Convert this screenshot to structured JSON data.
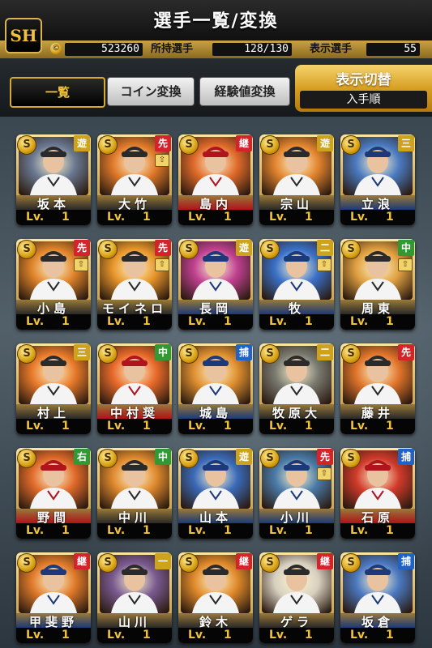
{
  "header": {
    "title": "選手一覧/変換",
    "logo_text": "SH",
    "coins": "523260",
    "owned_label": "所持選手",
    "owned_value": "128/130",
    "shown_label": "表示選手",
    "shown_value": "55"
  },
  "tabs": [
    {
      "label": "一覧",
      "active": true
    },
    {
      "label": "コイン変換",
      "active": false
    },
    {
      "label": "経験値変換",
      "active": false
    }
  ],
  "sort": {
    "title": "表示切替",
    "value": "入手順"
  },
  "colors": {
    "gold": "#f0c23a",
    "pos_red": "#d3242c",
    "pos_yellow": "#cfa21c",
    "pos_green": "#2f9a34",
    "pos_blue": "#1f62c8"
  },
  "cards": [
    {
      "name": "坂本",
      "pos": "遊",
      "pos_color": "#cfa21c",
      "lv_label": "Lv.",
      "lv": "1",
      "bg": "#6a7890",
      "frame": "#c8a050",
      "ribbon": "#2a2a2a"
    },
    {
      "name": "大竹",
      "pos": "先",
      "pos_color": "#d3242c",
      "lv_label": "Lv.",
      "lv": "1",
      "bg": "#e07a2a",
      "frame": "#d5a040",
      "ribbon": "#2a2a2a",
      "up": true
    },
    {
      "name": "島内",
      "pos": "継",
      "pos_color": "#d3242c",
      "lv_label": "Lv.",
      "lv": "1",
      "bg": "#e06a2a",
      "frame": "#d5a040",
      "ribbon": "#b0141c"
    },
    {
      "name": "宗山",
      "pos": "遊",
      "pos_color": "#cfa21c",
      "lv_label": "Lv.",
      "lv": "1",
      "bg": "#e2842e",
      "frame": "#d5a040",
      "ribbon": "#2a2a2a"
    },
    {
      "name": "立浪",
      "pos": "三",
      "pos_color": "#cfa21c",
      "lv_label": "Lv.",
      "lv": "1",
      "bg": "#4a7ac0",
      "frame": "#c8a050",
      "ribbon": "#1c3a7a"
    },
    {
      "name": "小島",
      "pos": "先",
      "pos_color": "#d3242c",
      "lv_label": "Lv.",
      "lv": "1",
      "bg": "#e0842a",
      "frame": "#d5a040",
      "ribbon": "#2a2a2a",
      "up": true
    },
    {
      "name": "モイネロ",
      "pos": "先",
      "pos_color": "#d3242c",
      "lv_label": "Lv.",
      "lv": "1",
      "bg": "#e8962a",
      "frame": "#d5a040",
      "ribbon": "#2a2a2a",
      "up": true
    },
    {
      "name": "長岡",
      "pos": "遊",
      "pos_color": "#cfa21c",
      "lv_label": "Lv.",
      "lv": "1",
      "bg": "#c04090",
      "frame": "#c8a050",
      "ribbon": "#1c3a7a"
    },
    {
      "name": "牧",
      "pos": "二",
      "pos_color": "#cfa21c",
      "lv_label": "Lv.",
      "lv": "1",
      "bg": "#3a70c8",
      "frame": "#c8a050",
      "ribbon": "#1c3a7a",
      "up": true
    },
    {
      "name": "周東",
      "pos": "中",
      "pos_color": "#2f9a34",
      "lv_label": "Lv.",
      "lv": "1",
      "bg": "#e0a040",
      "frame": "#d5a040",
      "ribbon": "#2a2a2a",
      "up": true
    },
    {
      "name": "村上",
      "pos": "三",
      "pos_color": "#cfa21c",
      "lv_label": "Lv.",
      "lv": "1",
      "bg": "#e87a2a",
      "frame": "#d5a040",
      "ribbon": "#2a2a2a"
    },
    {
      "name": "中村奨",
      "pos": "中",
      "pos_color": "#2f9a34",
      "lv_label": "Lv.",
      "lv": "1",
      "bg": "#e86a2a",
      "frame": "#d5a040",
      "ribbon": "#b0141c"
    },
    {
      "name": "城島",
      "pos": "捕",
      "pos_color": "#1f62c8",
      "lv_label": "Lv.",
      "lv": "1",
      "bg": "#e09030",
      "frame": "#d5a040",
      "ribbon": "#1c3a7a"
    },
    {
      "name": "牧原大",
      "pos": "二",
      "pos_color": "#cfa21c",
      "lv_label": "Lv.",
      "lv": "1",
      "bg": "#7a7a70",
      "frame": "#c8a050",
      "ribbon": "#2a2a2a"
    },
    {
      "name": "藤井",
      "pos": "先",
      "pos_color": "#d3242c",
      "lv_label": "Lv.",
      "lv": "1",
      "bg": "#e0742a",
      "frame": "#d5a040",
      "ribbon": "#2a2a2a"
    },
    {
      "name": "野間",
      "pos": "右",
      "pos_color": "#2f9a34",
      "lv_label": "Lv.",
      "lv": "1",
      "bg": "#e06a2a",
      "frame": "#d5a040",
      "ribbon": "#b0141c"
    },
    {
      "name": "中川",
      "pos": "中",
      "pos_color": "#2f9a34",
      "lv_label": "Lv.",
      "lv": "1",
      "bg": "#e08a2e",
      "frame": "#d5a040",
      "ribbon": "#2a2a2a"
    },
    {
      "name": "山本",
      "pos": "遊",
      "pos_color": "#cfa21c",
      "lv_label": "Lv.",
      "lv": "1",
      "bg": "#3a6ab8",
      "frame": "#c8a050",
      "ribbon": "#1c3a7a"
    },
    {
      "name": "小川",
      "pos": "先",
      "pos_color": "#d3242c",
      "lv_label": "Lv.",
      "lv": "1",
      "bg": "#4a7aa8",
      "frame": "#c8a050",
      "ribbon": "#1c3a7a",
      "up": true
    },
    {
      "name": "石原",
      "pos": "捕",
      "pos_color": "#1f62c8",
      "lv_label": "Lv.",
      "lv": "1",
      "bg": "#d03a2a",
      "frame": "#d5a040",
      "ribbon": "#b0141c"
    },
    {
      "name": "甲斐野",
      "pos": "継",
      "pos_color": "#d3242c",
      "lv_label": "Lv.",
      "lv": "1",
      "bg": "#e07a2a",
      "frame": "#d5a040",
      "ribbon": "#1c3a7a"
    },
    {
      "name": "山川",
      "pos": "一",
      "pos_color": "#cfa21c",
      "lv_label": "Lv.",
      "lv": "1",
      "bg": "#7a5a90",
      "frame": "#c8a050",
      "ribbon": "#2a2a2a"
    },
    {
      "name": "鈴木",
      "pos": "継",
      "pos_color": "#d3242c",
      "lv_label": "Lv.",
      "lv": "1",
      "bg": "#e08a2a",
      "frame": "#d5a040",
      "ribbon": "#2a2a2a"
    },
    {
      "name": "ゲラ",
      "pos": "継",
      "pos_color": "#d3242c",
      "lv_label": "Lv.",
      "lv": "1",
      "bg": "#d8d0c0",
      "frame": "#d5a040",
      "ribbon": "#2a2a2a"
    },
    {
      "name": "坂倉",
      "pos": "捕",
      "pos_color": "#1f62c8",
      "lv_label": "Lv.",
      "lv": "1",
      "bg": "#4a78c0",
      "frame": "#c8a050",
      "ribbon": "#1c3a7a"
    }
  ]
}
